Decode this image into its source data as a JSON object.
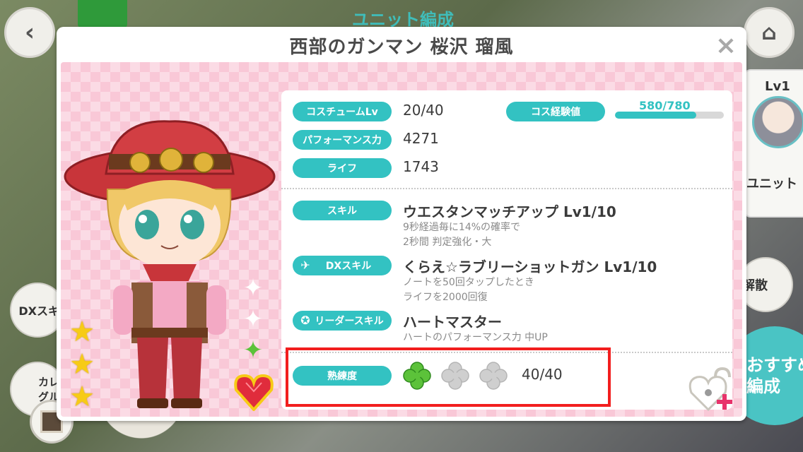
{
  "background": {
    "screen_title": "ユニット編成",
    "left_side_items": [
      "DXスキ",
      "カレ\nグル"
    ],
    "right_side_items": [
      "解散",
      "おすすめ\n編成"
    ],
    "unit_card": {
      "level": "Lv1",
      "label": "ユニット"
    }
  },
  "modal": {
    "title": "西部のガンマン 桜沢 瑠風",
    "close_symbol": "×"
  },
  "character": {
    "rarity_stars": 3,
    "sparkle_symbols": [
      "✦",
      "✦",
      "✦"
    ]
  },
  "stats": {
    "costume_lv_label": "コスチュームLv",
    "costume_lv_value": "20/40",
    "cos_exp_label": "コス経験値",
    "cos_exp_value": "580/780",
    "cos_exp_progress": 0.7436,
    "performance_label": "パフォーマンス力",
    "performance_value": "4271",
    "life_label": "ライフ",
    "life_value": "1743"
  },
  "skills": {
    "skill_label": "スキル",
    "skill_name": "ウエスタンマッチアップ Lv1/10",
    "skill_desc_1": "9秒経過毎に14%の確率で",
    "skill_desc_2": "2秒間 判定強化・大",
    "dx_label": "DXスキル",
    "dx_name": "くらえ☆ラブリーショットガン Lv1/10",
    "dx_desc_1": "ノートを50回タップしたとき",
    "dx_desc_2": "ライフを2000回復",
    "leader_label": "リーダースキル",
    "leader_name": "ハートマスター",
    "leader_desc": "ハートのパフォーマンス力 中UP"
  },
  "proficiency": {
    "label": "熟練度",
    "value": "40/40",
    "clovers_filled": 1,
    "clovers_total": 3
  },
  "colors": {
    "accent_teal": "#33c2c2",
    "panel_pink": "#f9c8d7",
    "highlight_red": "#f21e1e",
    "clover_green": "#5cc23a",
    "star_gold": "#f7cb16"
  }
}
